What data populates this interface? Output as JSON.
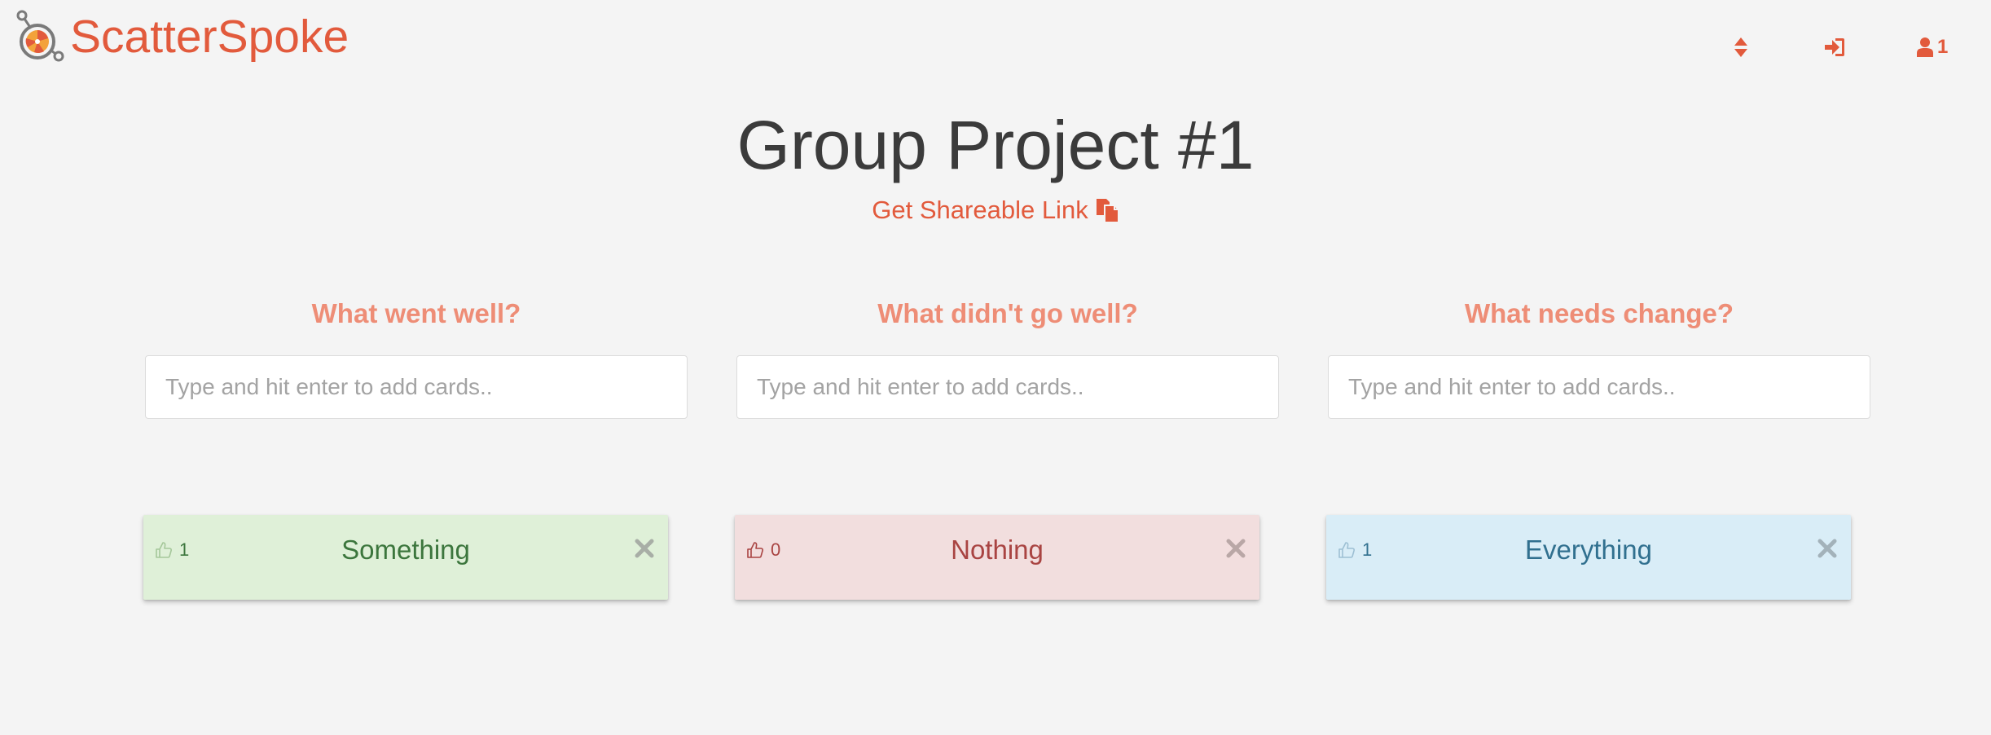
{
  "navbar": {
    "brand_name": "ScatterSpoke",
    "icons": {
      "sort": "sort-icon",
      "login": "sign-in-icon",
      "user": "user-icon"
    },
    "user_count": "1"
  },
  "board": {
    "title": "Group Project #1",
    "share_link_label": "Get Shareable Link",
    "share_icon": "copy-icon"
  },
  "columns": [
    {
      "heading": "What went well?",
      "input_placeholder": "Type and hit enter to add cards..",
      "cards": [
        {
          "text": "Something",
          "likes": "1",
          "like_icon": "thumbs-up-outline-icon"
        }
      ]
    },
    {
      "heading": "What didn't go well?",
      "input_placeholder": "Type and hit enter to add cards..",
      "cards": [
        {
          "text": "Nothing",
          "likes": "0",
          "like_icon": "thumbs-up-outline-icon"
        }
      ]
    },
    {
      "heading": "What needs change?",
      "input_placeholder": "Type and hit enter to add cards..",
      "cards": [
        {
          "text": "Everything",
          "likes": "1",
          "like_icon": "thumbs-up-outline-icon"
        }
      ]
    }
  ],
  "colors": {
    "brand": "#e25a3c",
    "heading": "#ee8d76",
    "title": "#3b3b3b",
    "background": "#f4f4f4",
    "card_well_bg": "#dff0d8",
    "card_well_text": "#3c763d",
    "card_notwell_bg": "#f2dede",
    "card_notwell_text": "#a94442",
    "card_change_bg": "#d9edf7",
    "card_change_text": "#31708f"
  }
}
